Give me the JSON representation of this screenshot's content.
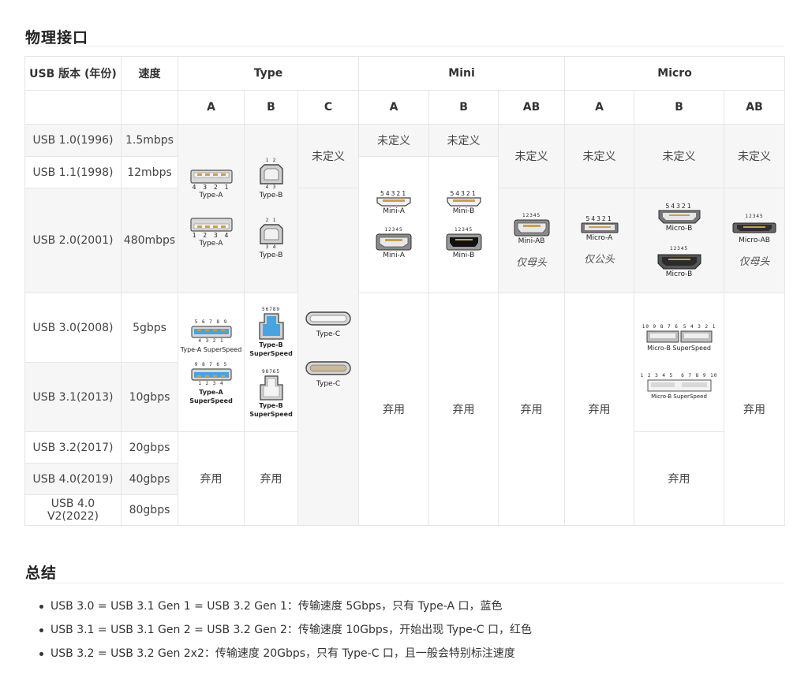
{
  "sections": {
    "physical_title": "物理接口",
    "summary_title": "总结"
  },
  "table": {
    "header1": {
      "version": "USB 版本 (年份)",
      "speed": "速度",
      "type": "Type",
      "mini": "Mini",
      "micro": "Micro"
    },
    "header2": {
      "type_a": "A",
      "type_b": "B",
      "type_c": "C",
      "mini_a": "A",
      "mini_b": "B",
      "mini_ab": "AB",
      "micro_a": "A",
      "micro_b": "B",
      "micro_ab": "AB"
    },
    "rows": [
      {
        "version": "USB 1.0(1996)",
        "speed": "1.5mbps"
      },
      {
        "version": "USB 1.1(1998)",
        "speed": "12mbps"
      },
      {
        "version": "USB 2.0(2001)",
        "speed": "480mbps"
      },
      {
        "version": "USB 3.0(2008)",
        "speed": "5gbps"
      },
      {
        "version": "USB 3.1(2013)",
        "speed": "10gbps"
      },
      {
        "version": "USB 3.2(2017)",
        "speed": "20gbps"
      },
      {
        "version": "USB 4.0(2019)",
        "speed": "40gbps"
      },
      {
        "version": "USB 4.0 V2(2022)",
        "speed": "80gbps"
      }
    ],
    "cells": {
      "undefined": "未定义",
      "deprecated": "弃用",
      "female_only": "仅母头",
      "male_only": "仅公头"
    },
    "connectors": {
      "type_a": "Type-A",
      "type_b": "Type-B",
      "type_a_ss": "Type-A SuperSpeed",
      "type_a_ss_l1": "Type-A",
      "type_a_ss_l2": "SuperSpeed",
      "type_b_ss_l1": "Type-B",
      "type_b_ss_l2": "SuperSpeed",
      "type_c": "Type-C",
      "mini_a": "Mini-A",
      "mini_b": "Mini-B",
      "mini_ab": "Mini-AB",
      "micro_a": "Micro-A",
      "micro_b": "Micro-B",
      "micro_ab": "Micro-AB",
      "micro_b_ss": "Micro-B SuperSpeed",
      "micro_b_ss2": "Micro-B SuperSpeed",
      "pins_a1": "4 3 2 1",
      "pins_a2": "1 2 3 4",
      "pins_b_top": "1 2",
      "pins_b_bot": "4 3",
      "pins_b2_top": "2 1",
      "pins_b2_bot": "3 4",
      "pins_54321": "54321",
      "pins_12345": "12345",
      "pins_ss_top": "5 6 7 8 9",
      "pins_ss_bot": "4 3 2 1",
      "pins_ss2_top": "9 8 7 6 5",
      "pins_ss2_bot": "1 2 3 4",
      "pins_b_ss_top": "56789",
      "pins_b_ss2_top": "98765",
      "pins_micro_ss_l": "10 9 8 7 6",
      "pins_micro_ss_r": "5 4 3 2 1",
      "pins_micro_ss2_l": "1 2 3 4 5",
      "pins_micro_ss2_r": "6 7 8 9 10"
    }
  },
  "summary": [
    "USB 3.0 = USB 3.1 Gen 1 = USB 3.2 Gen 1：传输速度 5Gbps，只有 Type-A 口，蓝色",
    "USB 3.1 = USB 3.1 Gen 2 = USB 3.2 Gen 2：传输速度 10Gbps，开始出现 Type-C 口，红色",
    "USB 3.2 = USB 3.2 Gen 2x2：传输速度 20Gbps，只有 Type-C 口，且一般会特别标注速度"
  ],
  "colors": {
    "superspeed_blue": "#4aa3df",
    "connector_grey": "#c8c8c8",
    "connector_dark": "#444444"
  }
}
